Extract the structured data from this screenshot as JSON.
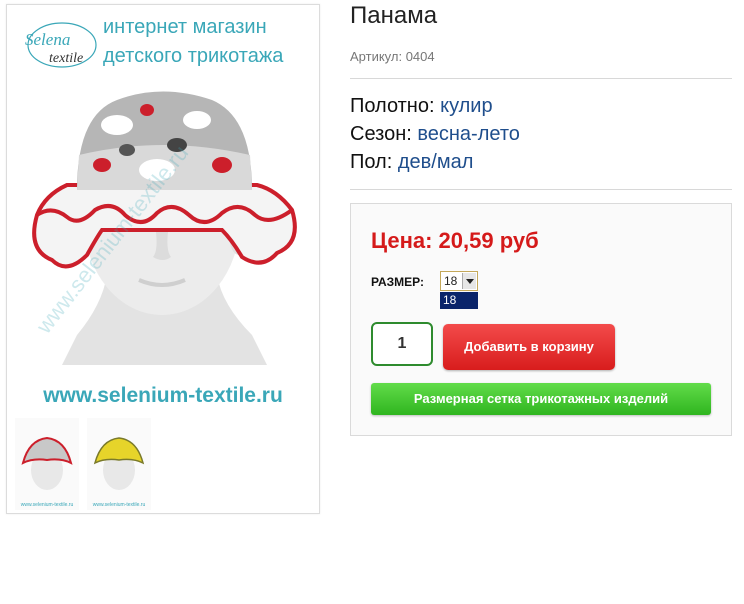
{
  "product": {
    "title": "Панама",
    "article": "Артикул: 0404",
    "specs": [
      {
        "label": "Полотно:",
        "value": "кулир"
      },
      {
        "label": "Сезон:",
        "value": "весна-лето"
      },
      {
        "label": "Пол:",
        "value": "дев/мал"
      }
    ]
  },
  "image": {
    "brand_script": "Selena",
    "brand_sub": "textile",
    "banner_line1": "интернет магазин",
    "banner_line2": "детского трикотажа",
    "website": "www.selenium-textile.ru"
  },
  "thumbnails": [
    {
      "caption": "www.selenium-textile.ru",
      "hat_color": "#c8c8c8"
    },
    {
      "caption": "www.selenium-textile.ru",
      "hat_color": "#e6d42a"
    }
  ],
  "buy": {
    "price": "Цена: 20,59 руб",
    "size_label": "РАЗМЕР:",
    "size_selected": "18",
    "size_option": "18",
    "quantity": "1",
    "add_to_cart": "Добавить в корзину",
    "size_chart": "Размерная сетка трикотажных изделий"
  },
  "colors": {
    "price": "#d51a1a",
    "link": "#1f4e8c",
    "cart_button": "#e22a2a",
    "chart_button": "#3fc22d",
    "brand_teal": "#3aa7b8"
  }
}
